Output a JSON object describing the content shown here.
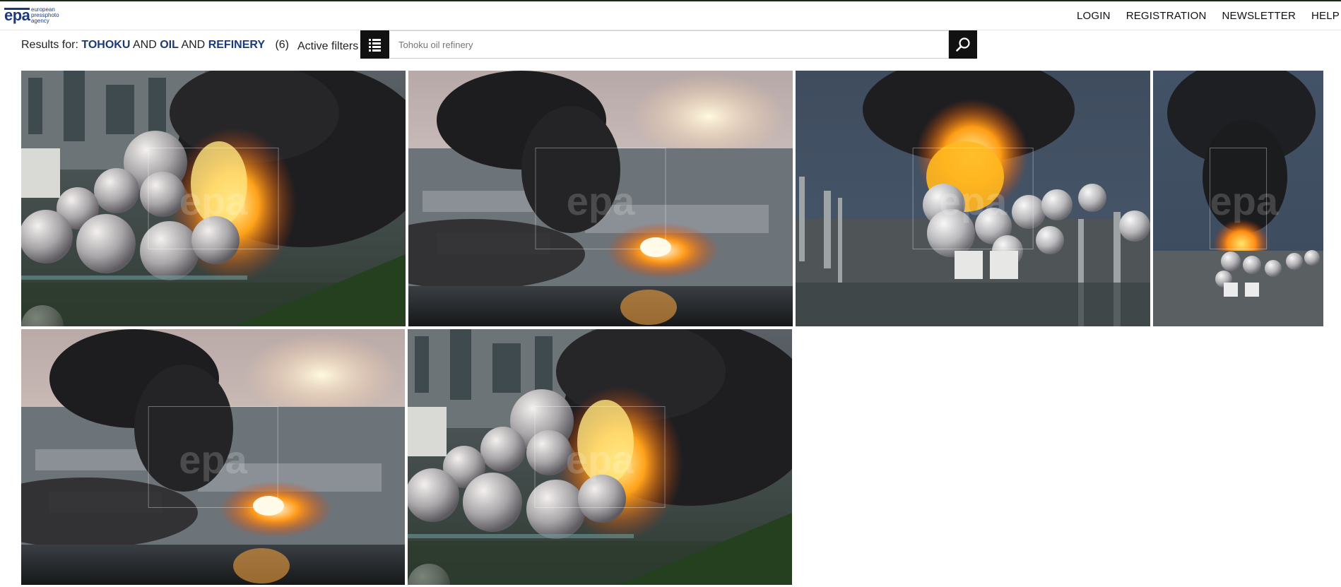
{
  "site": {
    "logo_mark": "epa",
    "logo_text_1": "european",
    "logo_text_2": "pressphoto",
    "logo_text_3": "agency"
  },
  "nav": {
    "login": "LOGIN",
    "registration": "REGISTRATION",
    "newsletter": "NEWSLETTER",
    "help": "HELP"
  },
  "results": {
    "prefix": "Results for:",
    "term1": "TOHOKU",
    "op1": "AND",
    "term2": "OIL",
    "op2": "AND",
    "term3": "REFINERY",
    "count": "(6)",
    "active_filters": "Active filters"
  },
  "search": {
    "placeholder": "Tohoku oil refinery"
  },
  "icons": {
    "filter": "list-icon",
    "search": "magnifier-icon"
  },
  "watermark": "epa",
  "colors": {
    "brand": "#1b3a7a",
    "button_bg": "#111111"
  },
  "photos": [
    {
      "id": "p1",
      "scene": "tanks-left-fire"
    },
    {
      "id": "p2",
      "scene": "wide-smoke-sunset"
    },
    {
      "id": "p3",
      "scene": "fireball-tanks"
    },
    {
      "id": "p4",
      "scene": "smoke-column-narrow"
    },
    {
      "id": "p5",
      "scene": "wide-smoke-sunset"
    },
    {
      "id": "p6",
      "scene": "tanks-left-fire"
    }
  ]
}
